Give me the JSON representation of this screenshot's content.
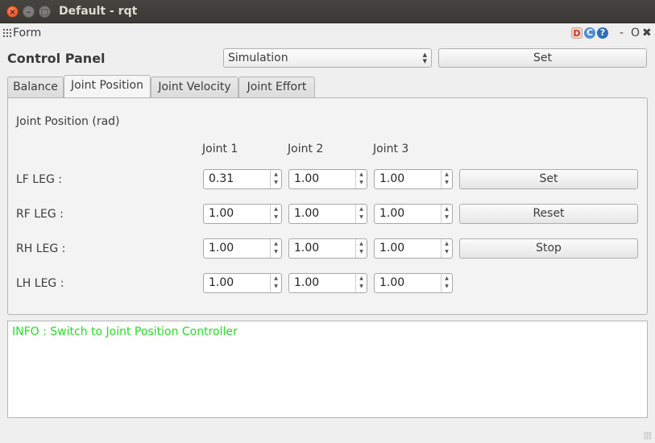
{
  "window": {
    "title": "Default - rqt",
    "close_glyph": "×",
    "min_glyph": "–",
    "max_glyph": "□"
  },
  "plugin": {
    "name": "Form",
    "icons": {
      "d": "D",
      "c": "C",
      "help": "?"
    },
    "dash": "-",
    "o": "O",
    "x": "✖"
  },
  "control_panel": {
    "title": "Control Panel",
    "mode_select": {
      "value": "Simulation"
    },
    "set_button": "Set"
  },
  "tabs": [
    {
      "label": "Balance",
      "active": false
    },
    {
      "label": "Joint Position",
      "active": true
    },
    {
      "label": "Joint Velocity",
      "active": false
    },
    {
      "label": "Joint Effort",
      "active": false
    }
  ],
  "joint_position": {
    "heading": "Joint Position (rad)",
    "columns": [
      "Joint 1",
      "Joint 2",
      "Joint 3"
    ],
    "rows": [
      {
        "label": "LF LEG :",
        "values": [
          "0.31",
          "1.00",
          "1.00"
        ]
      },
      {
        "label": "RF LEG :",
        "values": [
          "1.00",
          "1.00",
          "1.00"
        ]
      },
      {
        "label": "RH LEG :",
        "values": [
          "1.00",
          "1.00",
          "1.00"
        ]
      },
      {
        "label": "LH LEG :",
        "values": [
          "1.00",
          "1.00",
          "1.00"
        ]
      }
    ],
    "buttons": {
      "set": "Set",
      "reset": "Reset",
      "stop": "Stop"
    }
  },
  "log": {
    "line": "INFO : Switch to Joint Position Controller",
    "color": "#22e022"
  }
}
